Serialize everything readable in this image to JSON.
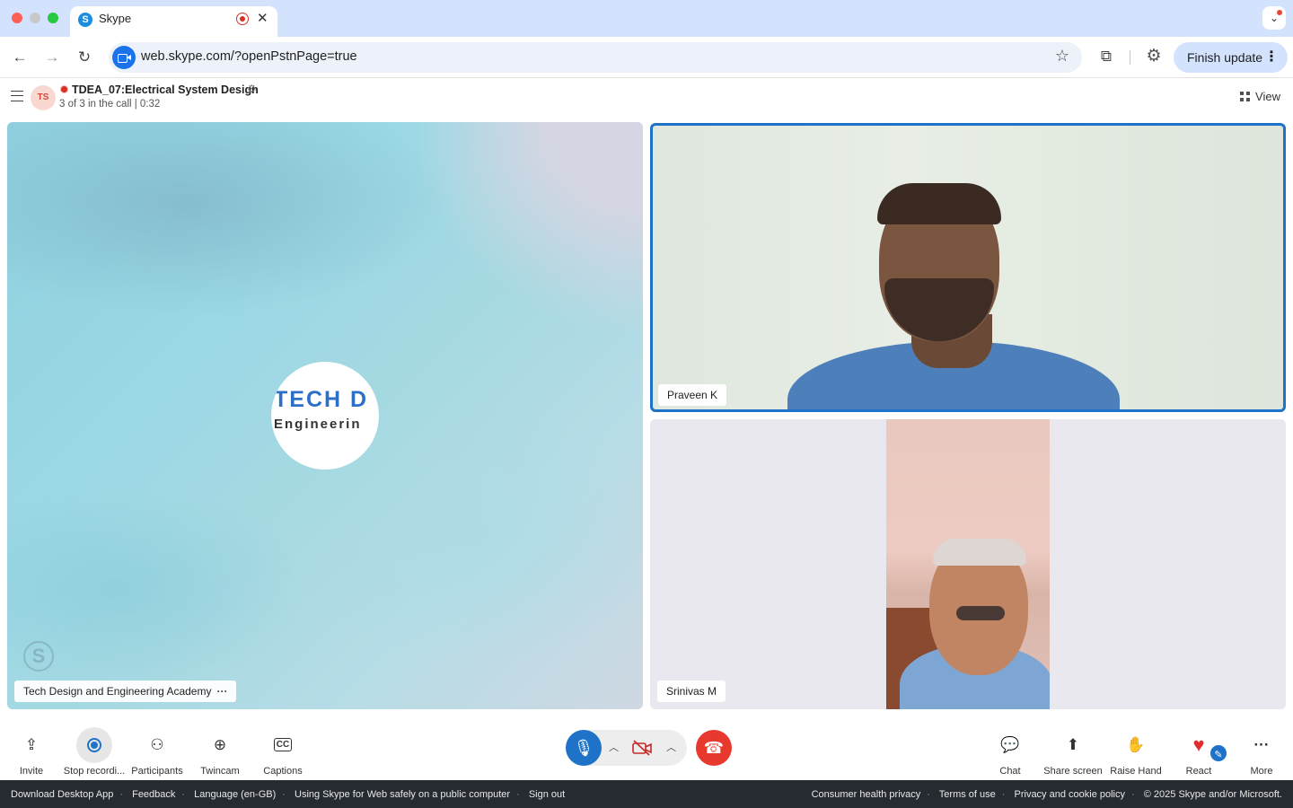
{
  "browser": {
    "tab_title": "Skype",
    "tab_favicon_letter": "S",
    "tab_close": "✕",
    "url": "web.skype.com/?openPstnPage=true",
    "finish_update_label": "Finish update"
  },
  "call": {
    "avatar_initials": "TS",
    "title": "TDEA_07:Electrical System Design",
    "subtitle": "3 of 3 in the call | 0:32",
    "view_label": "View"
  },
  "tiles": {
    "main": {
      "logo_line1": "TECH D",
      "logo_line2": "Engineerin",
      "name": "Tech Design and Engineering Academy",
      "watermark": "S"
    },
    "praveen": {
      "name": "Praveen K"
    },
    "srinivas": {
      "name": "Srinivas M"
    }
  },
  "controls": {
    "left": [
      {
        "label": "Invite",
        "icon": "share-icon"
      },
      {
        "label": "Stop recordi...",
        "icon": "record-icon"
      },
      {
        "label": "Participants",
        "icon": "people-icon"
      },
      {
        "label": "Twincam",
        "icon": "camera-add-icon"
      },
      {
        "label": "Captions",
        "icon": "cc-icon"
      }
    ],
    "right": [
      {
        "label": "Chat",
        "icon": "chat-icon"
      },
      {
        "label": "Share screen",
        "icon": "share-screen-icon"
      },
      {
        "label": "Raise Hand",
        "icon": "hand-icon"
      },
      {
        "label": "React",
        "icon": "heart-icon"
      },
      {
        "label": "More",
        "icon": "more-icon"
      }
    ]
  },
  "footer": {
    "download": "Download Desktop App",
    "feedback": "Feedback",
    "language": "Language (en-GB)",
    "safety": "Using Skype for Web safely on a public computer",
    "signout": "Sign out",
    "health": "Consumer health privacy",
    "terms": "Terms of use",
    "privacy": "Privacy and cookie policy",
    "copyright": "© 2025 Skype and/or Microsoft."
  },
  "colors": {
    "accent": "#1e73c9",
    "hangup": "#e8392e",
    "recording": "#d93025",
    "tab_strip": "#d3e3fd",
    "footer_bg": "#262a31"
  }
}
